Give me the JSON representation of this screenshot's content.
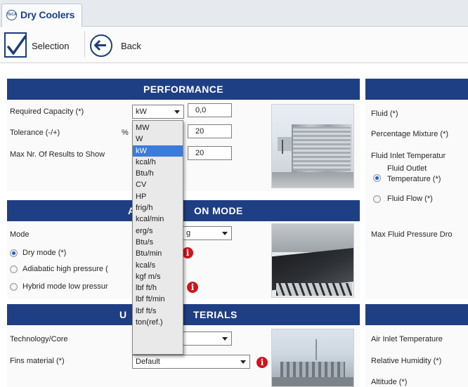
{
  "window": {
    "tab_title": "Dry Coolers",
    "logo_text": "TECA"
  },
  "toolbar": {
    "selection_label": "Selection",
    "back_label": "Back"
  },
  "performance": {
    "heading": "PERFORMANCE",
    "required_capacity_label": "Required Capacity (*)",
    "required_capacity_unit": "kW",
    "required_capacity_value": "0,0",
    "tolerance_label": "Tolerance (-/+)",
    "tolerance_unit": "%",
    "tolerance_value": "20",
    "max_results_label": "Max Nr. Of Results to Show",
    "max_results_value": "20"
  },
  "unit_dropdown": {
    "options": [
      "MW",
      "W",
      "kW",
      "kcal/h",
      "Btu/h",
      "CV",
      "HP",
      "frig/h",
      "kcal/min",
      "erg/s",
      "Btu/s",
      "Btu/min",
      "kcal/s",
      "kgf m/s",
      "lbf ft/h",
      "lbf ft/min",
      "lbf ft/s",
      "ton(ref.)"
    ],
    "selected": "kW"
  },
  "application_mode": {
    "heading_left": "AP",
    "heading_right": "ON MODE",
    "mode_label": "Mode",
    "mode_value_partial": "g",
    "dry_mode": "Dry mode (*)",
    "adiabatic": "Adiabatic high pressure (",
    "hybrid": "Hybrid mode low pressur"
  },
  "unit_materials": {
    "heading_left": "U",
    "heading_right": "TERIALS",
    "technology_label": "Technology/Core",
    "fins_label": "Fins material (*)",
    "fins_value": "Default"
  },
  "fluid": {
    "fluid_label": "Fluid (*)",
    "percentage_label": "Percentage Mixture (*)",
    "inlet_temp_label": "Fluid Inlet Temperatur",
    "outlet_temp_label_1": "Fluid Outlet",
    "outlet_temp_label_2": "Temperature (*)",
    "fluid_flow_label": "Fluid Flow (*)",
    "max_pressure_label": "Max Fluid Pressure Dro"
  },
  "air": {
    "air_inlet_label": "Air Inlet Temperature",
    "humidity_label": "Relative Humidity (*)",
    "altitude_label": "Altitude (*)"
  },
  "icons": {
    "selection": "checkmark-icon",
    "back": "arrow-left-circle-icon",
    "info": "info-icon",
    "dropdown": "chevron-down-icon"
  },
  "colors": {
    "panel_header": "#1f3f84",
    "selection_highlight": "#3a7bdc",
    "info_red": "#d3131b"
  }
}
